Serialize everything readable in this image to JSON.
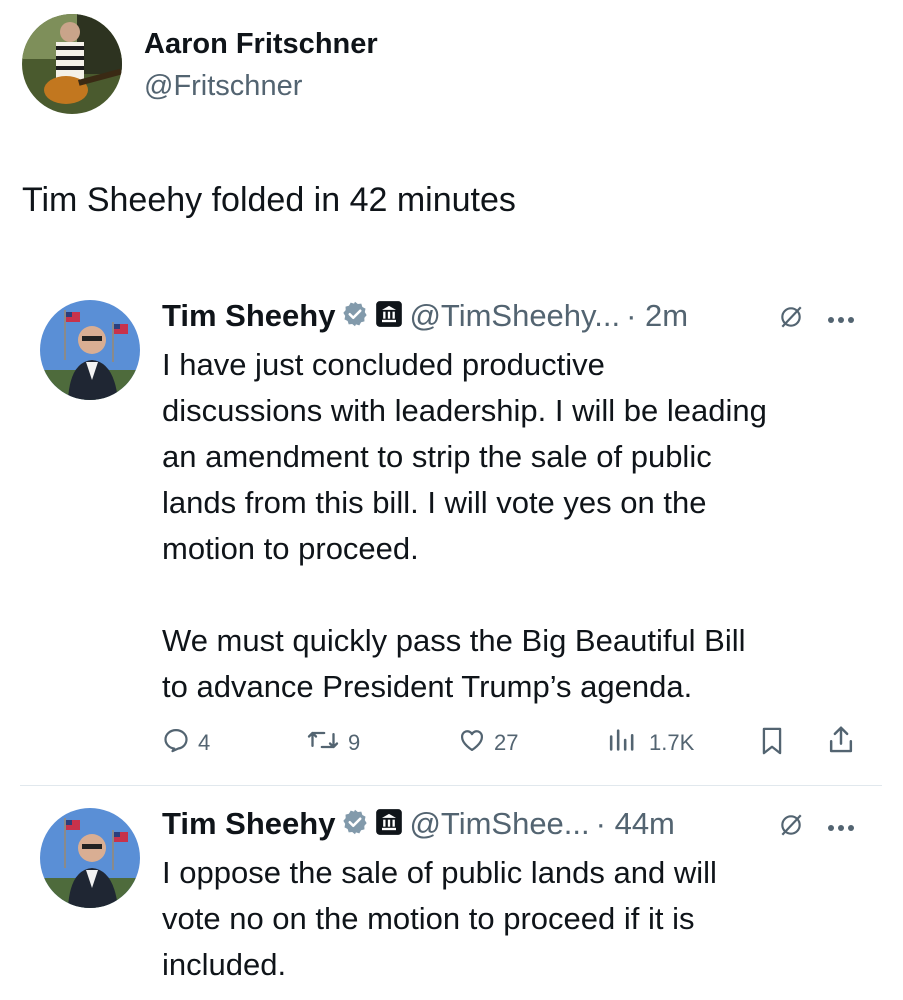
{
  "author": {
    "name": "Aaron Fritschner",
    "handle": "@Fritschner"
  },
  "post": {
    "text": "Tim Sheehy folded in 42 minutes"
  },
  "quotes": [
    {
      "name": "Tim Sheehy",
      "handle": "@TimSheehy...",
      "time": "· 2m",
      "text": "I have just concluded productive\ndiscussions with leadership. I will be leading\nan amendment to strip the sale of public\nlands from this bill. I will vote yes on the\nmotion to proceed.\n\nWe must quickly pass the Big Beautiful Bill\nto advance President Trump’s agenda.",
      "replies": "4",
      "reposts": "9",
      "likes": "27",
      "views": "1.7K"
    },
    {
      "name": "Tim Sheehy",
      "handle": "@TimShee...",
      "time": "· 44m",
      "text": "I oppose the sale of public lands and will\nvote no on the motion to proceed if it is\nincluded."
    }
  ],
  "icons": {
    "verified": "verified-badge-icon",
    "government": "government-building-icon",
    "grok": "grok-icon",
    "more": "more-icon",
    "reply": "reply-icon",
    "repost": "repost-icon",
    "like": "like-icon",
    "views": "views-icon",
    "bookmark": "bookmark-icon",
    "share": "share-icon"
  },
  "colors": {
    "text": "#0f1419",
    "secondary": "#536471",
    "verified": "#829aab",
    "divider": "#e1e8ed"
  }
}
